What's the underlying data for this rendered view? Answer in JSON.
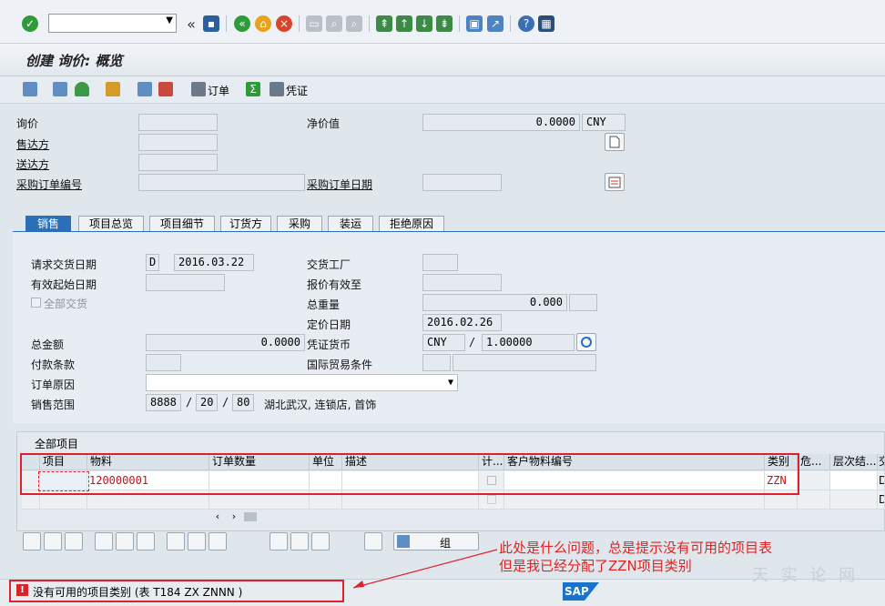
{
  "command_bar": {
    "command_field_value": ""
  },
  "title": "创建 询价: 概览",
  "app_toolbar": {
    "order_label": "订单",
    "doc_label": "凭证"
  },
  "header": {
    "inquiry_label": "询价",
    "sold_to_label": "售达方",
    "ship_to_label": "送达方",
    "po_number_label": "采购订单编号",
    "net_value_label": "净价值",
    "net_value": "0.0000",
    "currency": "CNY",
    "po_date_label": "采购订单日期"
  },
  "tabs": [
    "销售",
    "项目总览",
    "项目细节",
    "订货方",
    "采购",
    "装运",
    "拒绝原因"
  ],
  "sales_tab": {
    "req_delivery_date_label": "请求交货日期",
    "req_delivery_date_type": "D",
    "req_delivery_date": "2016.03.22",
    "delivering_plant_label": "交货工厂",
    "valid_from_label": "有效起始日期",
    "valid_to_label": "报价有效至",
    "complete_delivery_label": "全部交货",
    "total_weight_label": "总重量",
    "total_weight": "0.000",
    "pricing_date_label": "定价日期",
    "pricing_date": "2016.02.26",
    "total_amount_label": "总金额",
    "total_amount": "0.0000",
    "doc_currency_label": "凭证货币",
    "doc_currency": "CNY",
    "exchange_rate": "1.00000",
    "payment_terms_label": "付款条款",
    "incoterms_label": "国际贸易条件",
    "order_reason_label": "订单原因",
    "sales_area_label": "销售范围",
    "sales_org": "8888",
    "dist_channel": "20",
    "division": "80",
    "sales_area_desc": "湖北武汉, 连锁店, 首饰"
  },
  "items_table": {
    "title": "全部项目",
    "columns": [
      "项目",
      "物料",
      "订单数量",
      "单位",
      "描述",
      "计...",
      "客户物料编号",
      "类别",
      "危...",
      "层次结...",
      "交"
    ],
    "rows": [
      {
        "item": "",
        "material": "120000001",
        "qty": "",
        "unit": "",
        "desc": "",
        "cust_mat": "",
        "category": "ZZN",
        "last": "D"
      },
      {
        "item": "",
        "material": "",
        "qty": "",
        "unit": "",
        "desc": "",
        "cust_mat": "",
        "category": "",
        "last": "D"
      }
    ]
  },
  "bottom_toolbar": {
    "group_label": "组"
  },
  "status": {
    "message": "没有可用的项目类别 (表 T184 ZX ZNNN )"
  },
  "annotation": {
    "line1": "此处是什么问题，总是提示没有可用的项目表",
    "line2": "但是我已经分配了ZZN项目类别"
  },
  "brand": {
    "sap_logo": "SAP",
    "watermark": "天 实 论 网"
  },
  "colors": {
    "accent": "#2a6fb8",
    "annotation_red": "#e0202b"
  }
}
